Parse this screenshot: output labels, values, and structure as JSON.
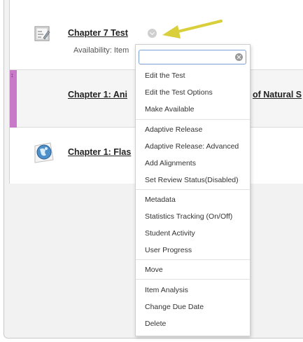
{
  "items": [
    {
      "title": "Chapter 7 Test",
      "icon": "test-icon",
      "availability": "Availability:  Item"
    },
    {
      "title": "Chapter 1: Ani",
      "title_overflow": "of Natural S",
      "icon": "web-globe-icon"
    },
    {
      "title": "Chapter 1: Flas",
      "icon": "web-globe-icon"
    }
  ],
  "menu": {
    "search": {
      "value": "",
      "placeholder": ""
    },
    "items": [
      "Edit the Test",
      "Edit the Test Options",
      "Make Available",
      "Adaptive Release",
      "Adaptive Release: Advanced",
      "Add Alignments",
      "Set Review Status(Disabled)",
      "Metadata",
      "Statistics Tracking (On/Off)",
      "Student Activity",
      "User Progress",
      "Move",
      "Item Analysis",
      "Change Due Date",
      "Delete"
    ]
  },
  "colors": {
    "drag_handle": "#c87ac8",
    "annotation_arrow": "#d9cf3a",
    "search_border": "#7b9fd6"
  }
}
